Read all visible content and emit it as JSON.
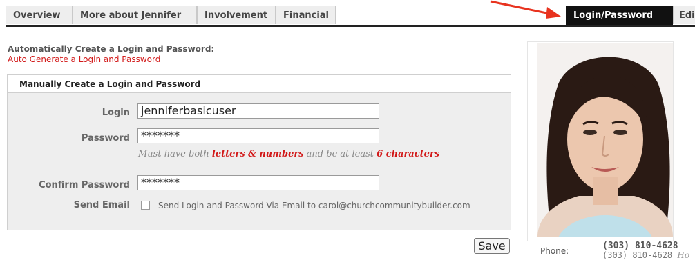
{
  "tabs": [
    {
      "label": "Overview"
    },
    {
      "label": "More about Jennifer"
    },
    {
      "label": "Involvement"
    },
    {
      "label": "Financial"
    },
    {
      "label": "Login/Password",
      "active": true
    },
    {
      "label": "Edi"
    }
  ],
  "auto": {
    "title": "Automatically Create a Login and Password:",
    "link": "Auto Generate a Login and Password"
  },
  "manual": {
    "title": "Manually Create a Login and Password",
    "login_label": "Login",
    "login_value": "jenniferbasicuser",
    "password_label": "Password",
    "password_value": "*******",
    "hint_prefix": "Must have both ",
    "hint_em1": "letters & numbers",
    "hint_mid": " and be at least ",
    "hint_em2": "6 characters",
    "confirm_label": "Confirm Password",
    "confirm_value": "*******",
    "send_label": "Send Email",
    "send_text": "Send Login and Password Via Email to carol@churchcommunitybuilder.com",
    "send_checked": false
  },
  "save_label": "Save",
  "profile": {
    "phone_label": "Phone:",
    "phone_primary": "(303) 810-4628",
    "phone_secondary": "(303) 810-4628",
    "phone_secondary_type": "Ho"
  },
  "colors": {
    "accent": "#d21a1a",
    "active_tab": "#111111",
    "panel": "#eeeeee"
  }
}
